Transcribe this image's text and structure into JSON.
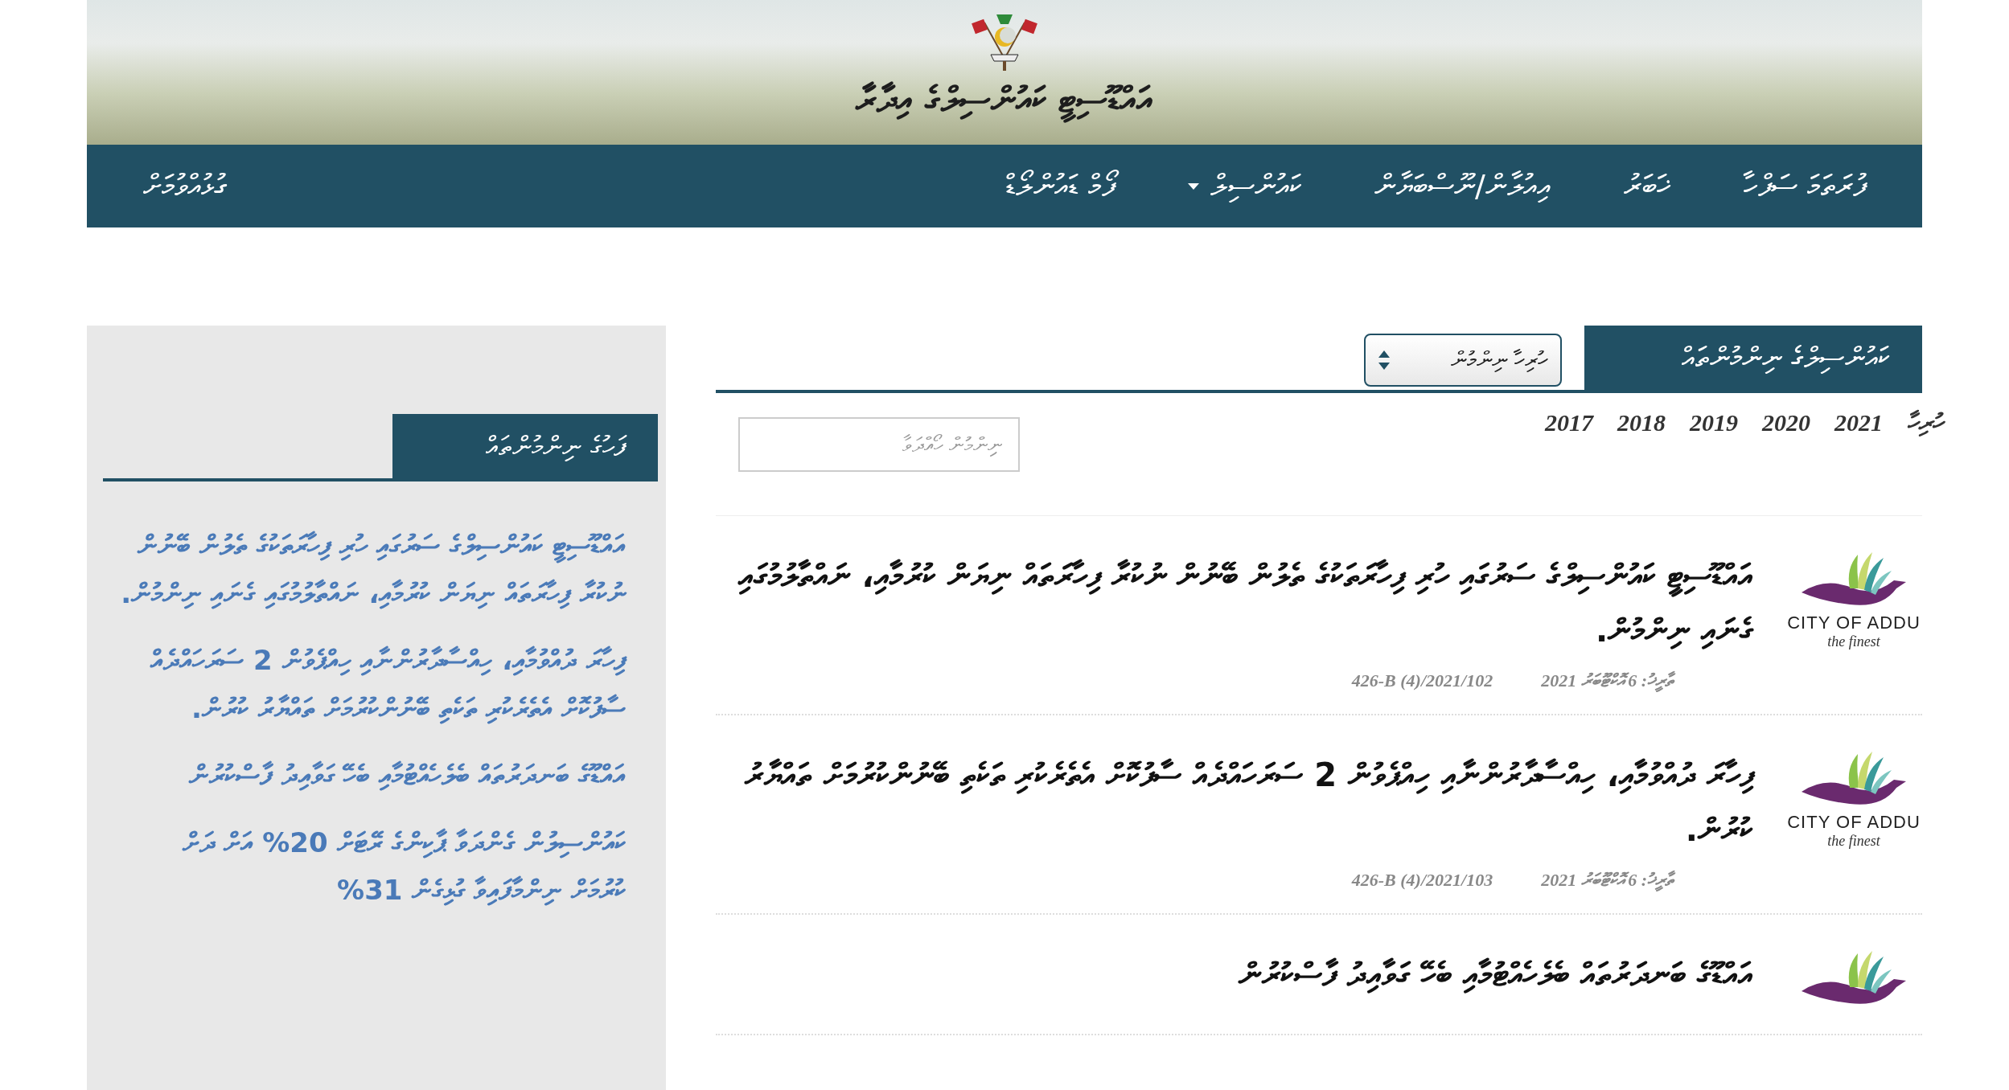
{
  "header": {
    "title": "އައްޑޫސިޓީ ކައުންސިލްގެ އިދާރާ"
  },
  "nav": {
    "items": [
      {
        "label": "ފުރަތަމަ ސަފްހާ",
        "dropdown": false
      },
      {
        "label": "ޚަބަރު",
        "dropdown": false
      },
      {
        "label": "އިއުލާން/ނޫސްބަޔާން",
        "dropdown": false
      },
      {
        "label": "ކައުންސިލް",
        "dropdown": true
      },
      {
        "label": "ފޯމް ޑައުންލޯޑް",
        "dropdown": false
      }
    ],
    "contact": "ގުޅުއްވުމަށް"
  },
  "tab": {
    "title": "ކައުންސިލްގެ ނިންމުންތައް",
    "filter": "ހުރިހާ ނިންމުން"
  },
  "years": [
    "ހުރިހާ",
    "2021",
    "2020",
    "2019",
    "2018",
    "2017"
  ],
  "search": {
    "placeholder": "ނިންމުން ހޯއްދަވާ"
  },
  "decisions": [
    {
      "title": "އައްޑޫސިޓީ ކައުންސިލްގެ ސަރުގައި ހުރި ފިހާރަތަކުގެ ތެލުން ބޭނުން ނުކުރާ ފިހާރަތައް ނިޔަން ކުރުމާއި، ނައްތާލުމުގައި ގެނައި ނިންމުން.",
      "date": "ތާރީޚު: 6 އޮކްޓޫބަރު 2021",
      "reference": "426-B (4)/2021/102",
      "logo_name": "CITY OF ADDU",
      "logo_tagline": "the finest"
    },
    {
      "title": "ފިހާރަ ދުއްވުމާއި، ހިއްސާދާރުންނާއި ހިއްޕެވުން 2 ސަރަހައްދެއް ސާފުކޮށް އެތެރެކުރި ތަކެތި ބޭނުންކުރުމަށް ތައްޔާރު ކުރުން.",
      "date": "ތާރީޚު: 6 އޮކްޓޫބަރު 2021",
      "reference": "426-B (4)/2021/103",
      "logo_name": "CITY OF ADDU",
      "logo_tagline": "the finest"
    },
    {
      "title": "އައްޑޫގެ ބަނދަރުތައް ބެލެހެއްޓުމާއި ބެހޭ ގަވާއިދު ފާސްކުރުން"
    }
  ],
  "sidebar": {
    "heading": "ފަހުގެ ނިންމުންތައް",
    "items": [
      "އައްޑޫސިޓީ ކައުންސިލްގެ ސަރުގައި ހުރި ފިހާރަތަކުގެ ތެލުން ބޭނުން ނުކުރާ ފިހާރަތައް ނިޔަން ކުރުމާއި، ނައްތާލުމުގައި ގެނައި ނިންމުން.",
      "ފިހާރަ ދުއްވުމާއި، ހިއްސާދާރުންނާއި ހިއްޕެވުން 2 ސަރަހައްދެއް ސާފުކޮށް އެތެރެކުރި ތަކެތި ބޭނުންކުރުމަށް ތައްޔާރު ކުރުން.",
      "އައްޑޫގެ ބަނދަރުތައް ބެލެހެއްޓުމާއި ބެހޭ ގަވާއިދު ފާސްކުރުން",
      "ކައުންސިލުން ގެންދަވާ ޕާކިންގެ ރޭޓަށް 20% އަށް ދަށް ކުރުމަށް ނިންމާފައިވާ ގުޅިގެން 31%"
    ]
  }
}
